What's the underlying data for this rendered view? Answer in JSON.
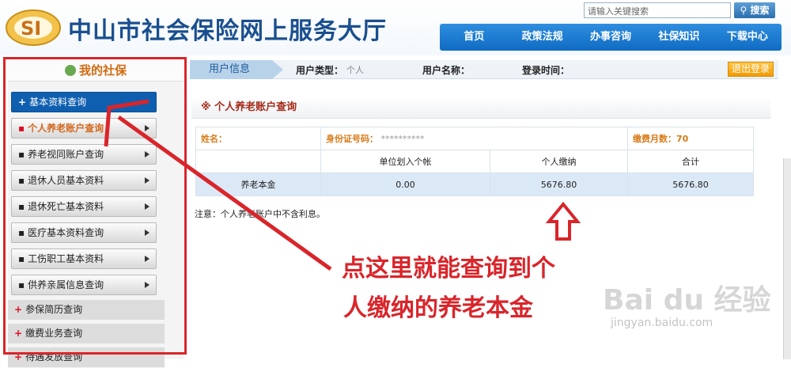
{
  "header": {
    "logo_text": "SI",
    "site_title": "中山市社会保险网上服务大厅",
    "search_placeholder": "请输入关键搜索",
    "search_button": "搜索",
    "nav": [
      "首页",
      "政策法规",
      "办事咨询",
      "社保知识",
      "下载中心"
    ]
  },
  "sidebar": {
    "title": "我的社保",
    "items": [
      {
        "label": "基本资料查询",
        "marker": "+"
      },
      {
        "label": "个人养老账户查询",
        "marker": "▪"
      },
      {
        "label": "养老视同账户查询",
        "marker": "▪"
      },
      {
        "label": "退休人员基本资料",
        "marker": "▪"
      },
      {
        "label": "退休死亡基本资料",
        "marker": "▪"
      },
      {
        "label": "医疗基本资料查询",
        "marker": "▪"
      },
      {
        "label": "工伤职工基本资料",
        "marker": "▪"
      },
      {
        "label": "供养亲属信息查询",
        "marker": "▪"
      },
      {
        "label": "参保简历查询",
        "marker": "+"
      },
      {
        "label": "缴费业务查询",
        "marker": "+"
      },
      {
        "label": "待遇发放查询",
        "marker": "+"
      }
    ]
  },
  "infobar": {
    "tab": "用户信息",
    "type_label": "用户类型：",
    "type_value": "个人",
    "name_label": "用户名称：",
    "login_label": "登录时间：",
    "logout": "退出登录"
  },
  "account": {
    "title": "※  个人养老账户查询",
    "name_label": "姓名：",
    "id_label": "身份证号码：",
    "id_value": "**********",
    "months_label": "缴费月数：",
    "months_value": "70",
    "headers": [
      "",
      "单位划入个帐",
      "个人缴纳",
      "合计"
    ],
    "row": [
      "养老本金",
      "0.00",
      "5676.80",
      "5676.80"
    ],
    "note": "注意：个人养老账户中不含利息。"
  },
  "annotation": {
    "line1": "点这里就能查询到个",
    "line2": "人缴纳的养老本金",
    "color": "#d9252a"
  },
  "watermark": {
    "brand": "Bai du 经验",
    "url": "jingyan.baidu.com"
  }
}
